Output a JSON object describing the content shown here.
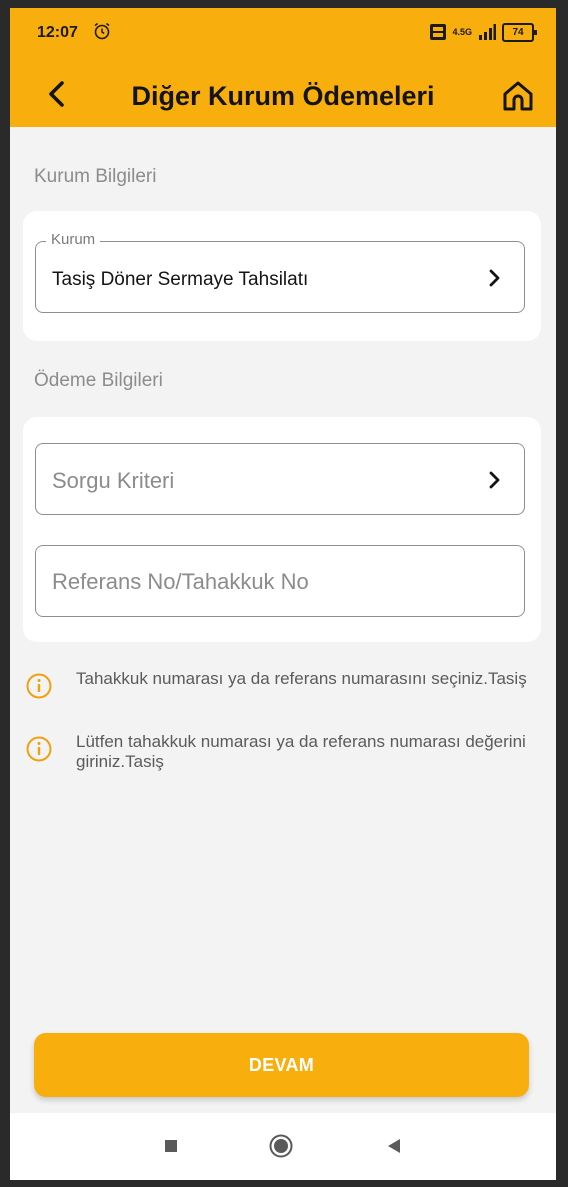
{
  "status_bar": {
    "time": "12:07",
    "network": "4.5G",
    "battery": "74"
  },
  "header": {
    "title": "Diğer Kurum Ödemeleri",
    "back_icon": "chevron-left-icon",
    "home_icon": "home-icon"
  },
  "institution_section": {
    "label": "Kurum Bilgileri",
    "field_label": "Kurum",
    "field_value": "Tasiş Döner Sermaye Tahsilatı"
  },
  "payment_section": {
    "label": "Ödeme Bilgileri",
    "query_placeholder": "Sorgu Kriteri",
    "reference_placeholder": "Referans No/Tahakkuk No"
  },
  "info_messages": [
    "Tahakkuk numarası ya da referans numarasını seçiniz.Tasiş",
    "Lütfen tahakkuk numarası ya da referans numarası değerini giriniz.Tasiş"
  ],
  "actions": {
    "continue_label": "DEVAM"
  },
  "colors": {
    "accent": "#f8ae0d",
    "background": "#f3f3f3"
  }
}
